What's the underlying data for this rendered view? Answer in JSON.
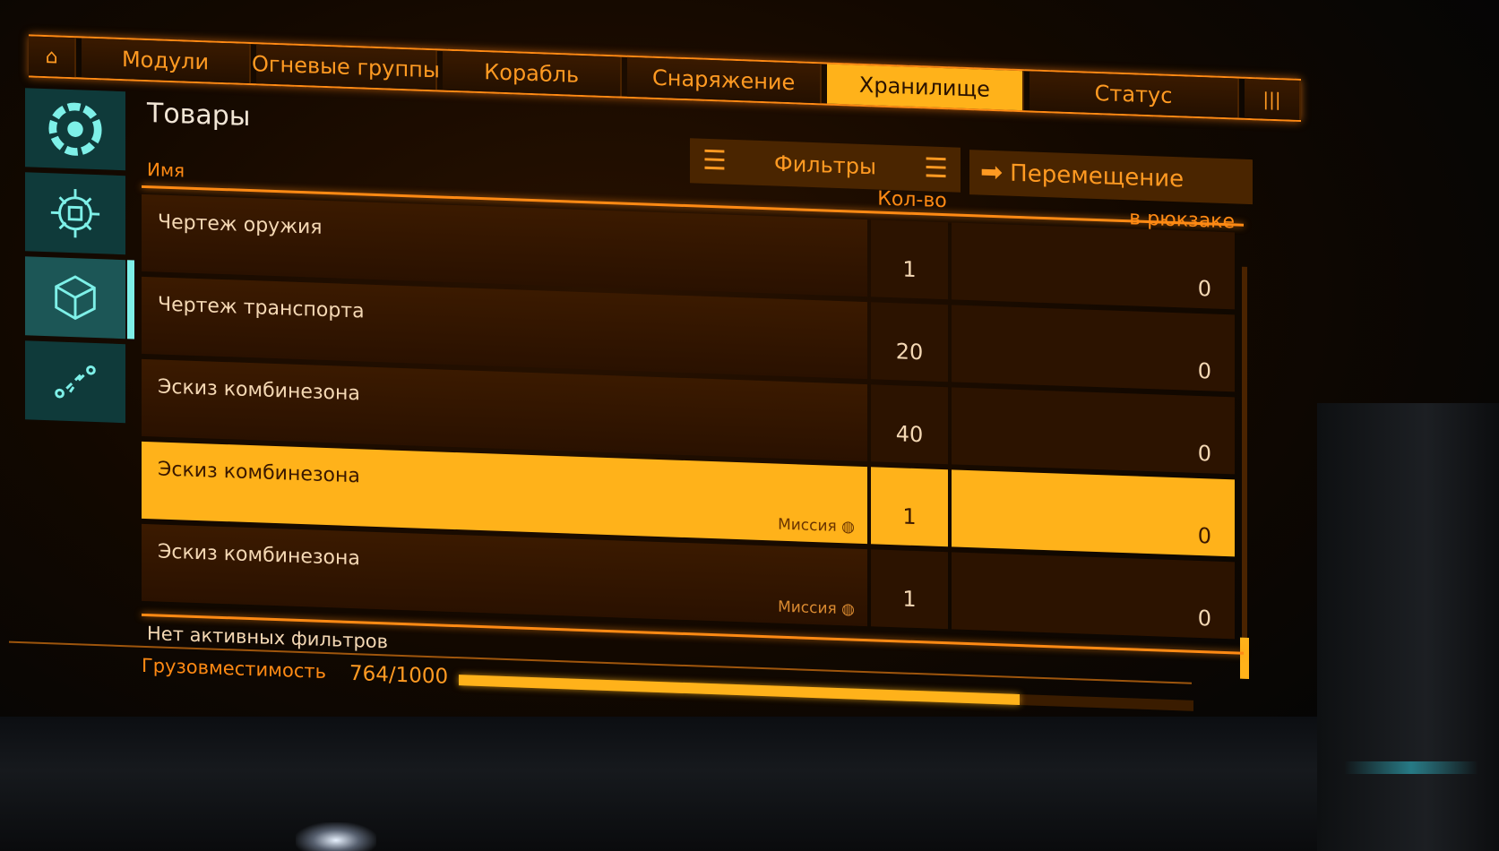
{
  "tabs": {
    "home_icon": "⌂",
    "modules": "Модули",
    "fire_groups": "Огневые группы",
    "ship": "Корабль",
    "equipment": "Снаряжение",
    "storage": "Хранилище",
    "status": "Статус",
    "audio_icon": "|||"
  },
  "sidebar": {
    "items": [
      {
        "icon": "ship-systems-icon"
      },
      {
        "icon": "chip-icon"
      },
      {
        "icon": "cargo-box-icon"
      },
      {
        "icon": "route-icon"
      }
    ],
    "active_index": 2
  },
  "panel": {
    "title": "Товары",
    "name_header": "Имя",
    "filters_label": "Фильтры",
    "move_label": "Перемещение",
    "qty_header": "Кол-во",
    "backpack_header": "в рюкзаке"
  },
  "rows": [
    {
      "name": "Чертеж оружия",
      "tag": "",
      "qty": "1",
      "backpack": "0"
    },
    {
      "name": "Чертеж транспорта",
      "tag": "",
      "qty": "20",
      "backpack": "0"
    },
    {
      "name": "Эскиз комбинезона",
      "tag": "",
      "qty": "40",
      "backpack": "0"
    },
    {
      "name": "Эскиз комбинезона",
      "tag": "Миссия ◍",
      "qty": "1",
      "backpack": "0"
    },
    {
      "name": "Эскиз комбинезона",
      "tag": "Миссия ◍",
      "qty": "1",
      "backpack": "0"
    }
  ],
  "selected_row": 3,
  "footer": {
    "no_filters": "Нет активных фильтров",
    "capacity_label": "Грузовместимость",
    "capacity_value": "764/1000",
    "capacity_fraction": 0.764
  },
  "colors": {
    "accent": "#ff8a14",
    "highlight": "#ffb21a",
    "sidebar": "#0f3a3a"
  }
}
